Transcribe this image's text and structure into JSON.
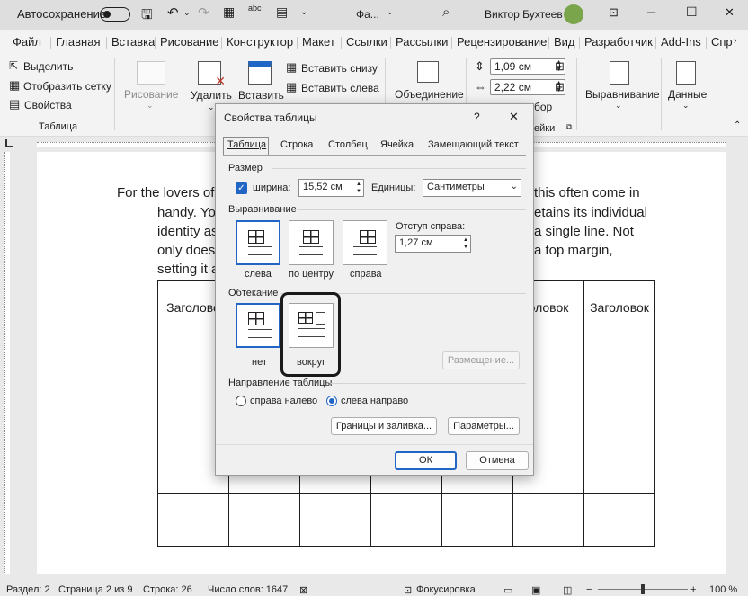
{
  "titlebar": {
    "autosave_label": "Автосохранение",
    "doc_name": "Фа...",
    "user_name": "Виктор Бухтеев",
    "minimize": "─",
    "maximize": "☐",
    "close": "✕"
  },
  "ribbon_tabs": [
    "Файл",
    "Главная",
    "Вставка",
    "Рисование",
    "Конструктор",
    "Макет",
    "Ссылки",
    "Рассылки",
    "Рецензирование",
    "Вид",
    "Разработчик",
    "Add-Ins",
    "Спр"
  ],
  "ribbon": {
    "select": "Выделить",
    "grid": "Отобразить сетку",
    "props": "Свойства",
    "group_table": "Таблица",
    "draw": "Рисование",
    "delete": "Удалить",
    "insert": "Вставить",
    "insert_below": "Вставить снизу",
    "insert_left": "Вставить слева",
    "merge": "Объединение",
    "height_val": "1,09 см",
    "width_val": "2,22 см",
    "align": "Выравнивание",
    "data": "Данные",
    "size_group_frag": "ейки",
    "autofit_frag": "бор"
  },
  "document": {
    "lines": [
      "For the lovers of p",
      "handy. You",
      "identity as",
      "only does t",
      "setting it a"
    ],
    "lines_right": [
      "this often come in",
      "etains its individual",
      "a single line. Not",
      "a top margin,"
    ],
    "header_left": "Заголово",
    "header_mid": "оловок",
    "header_right": "Заголовок"
  },
  "dialog": {
    "title": "Свойства таблицы",
    "help": "?",
    "close": "✕",
    "tabs": [
      "Таблица",
      "Строка",
      "Столбец",
      "Ячейка",
      "Замещающий текст"
    ],
    "size_label": "Размер",
    "width_label": "ширина:",
    "width_value": "15,52 см",
    "units_label": "Единицы:",
    "units_value": "Сантиметры",
    "align_label": "Выравнивание",
    "indent_label": "Отступ справа:",
    "indent_value": "1,27 см",
    "align_opts": [
      "слева",
      "по центру",
      "справа"
    ],
    "wrap_label": "Обтекание",
    "wrap_opts": [
      "нет",
      "вокруг"
    ],
    "placement_btn": "Размещение...",
    "direction_label": "Направление таблицы",
    "dir_rtl": "справа налево",
    "dir_ltr": "слева направо",
    "borders_btn": "Границы и заливка...",
    "options_btn": "Параметры...",
    "ok": "ОК",
    "cancel": "Отмена"
  },
  "status": {
    "section": "Раздел: 2",
    "page": "Страница 2 из 9",
    "line": "Строка: 26",
    "words": "Число слов: 1647",
    "focus": "Фокусировка",
    "zoom": "100 %"
  },
  "colors": {
    "accent": "#2166c5",
    "checkbox": "#2166c5"
  }
}
